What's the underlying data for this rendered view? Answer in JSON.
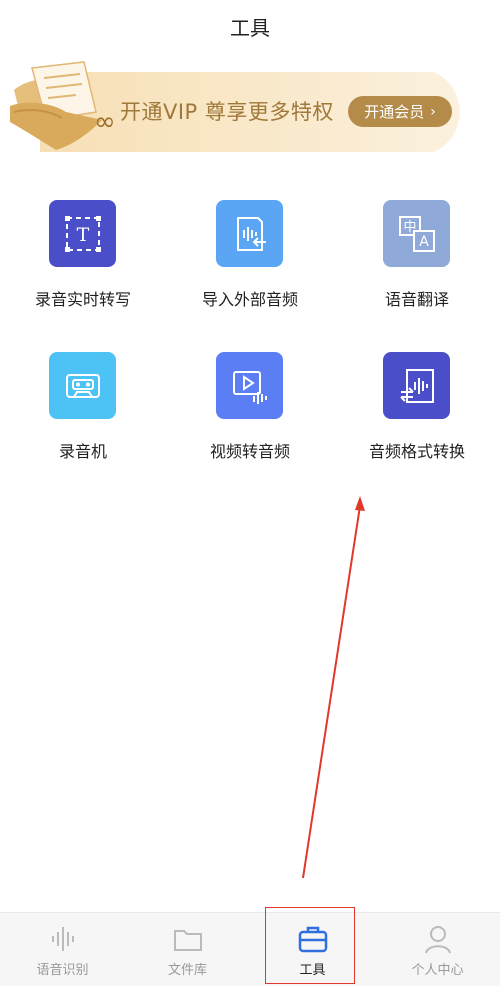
{
  "header": {
    "title": "工具"
  },
  "banner": {
    "text": "开通VIP 尊享更多特权",
    "button_label": "开通会员",
    "button_chevron": "›",
    "accent": "#b58b49",
    "background": "#fbeed6"
  },
  "tools": [
    {
      "label": "录音实时转写",
      "icon": "transcribe-text-icon",
      "color": "#4a4fc9"
    },
    {
      "label": "导入外部音频",
      "icon": "import-audio-icon",
      "color": "#5aa6f5"
    },
    {
      "label": "语音翻译",
      "icon": "translate-icon",
      "color": "#8fa9d8"
    },
    {
      "label": "录音机",
      "icon": "cassette-icon",
      "color": "#4dc3f5"
    },
    {
      "label": "视频转音频",
      "icon": "video-to-audio-icon",
      "color": "#5b7ef5"
    },
    {
      "label": "音频格式转换",
      "icon": "audio-convert-icon",
      "color": "#4a4fc9"
    }
  ],
  "tabbar": {
    "tabs": [
      {
        "label": "语音识别",
        "icon": "waveform-icon",
        "active": false
      },
      {
        "label": "文件库",
        "icon": "folder-icon",
        "active": false
      },
      {
        "label": "工具",
        "icon": "toolbox-icon",
        "active": true
      },
      {
        "label": "个人中心",
        "icon": "person-icon",
        "active": false
      }
    ],
    "active_color": "#2f6fe0"
  },
  "annotation": {
    "color": "#e0392b"
  }
}
